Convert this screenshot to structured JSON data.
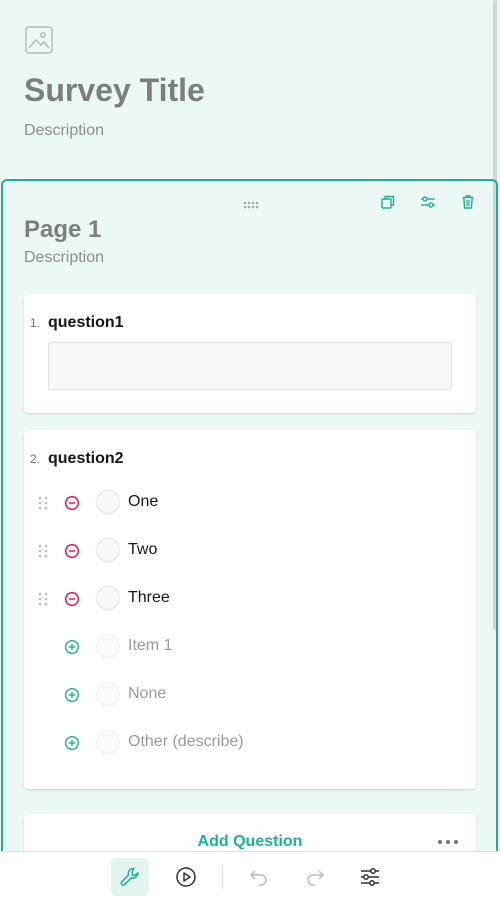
{
  "survey": {
    "title": "Survey Title",
    "description": "Description"
  },
  "page": {
    "title": "Page 1",
    "description": "Description"
  },
  "questions": [
    {
      "number": "1.",
      "title": "question1"
    },
    {
      "number": "2.",
      "title": "question2",
      "choices": [
        "One",
        "Two",
        "Three"
      ],
      "placeholders": [
        "Item 1",
        "None",
        "Other (describe)"
      ]
    }
  ],
  "footer": {
    "add_question": "Add Question"
  },
  "colors": {
    "accent": "#19b394",
    "remove": "#e60a3e",
    "background": "#ecf8f5"
  },
  "icons": {
    "logo": "image-icon",
    "page_actions": [
      "duplicate-icon",
      "settings-icon",
      "delete-icon"
    ],
    "toolbar": [
      "designer-icon",
      "preview-icon",
      "undo-icon",
      "redo-icon",
      "settings-icon"
    ]
  }
}
